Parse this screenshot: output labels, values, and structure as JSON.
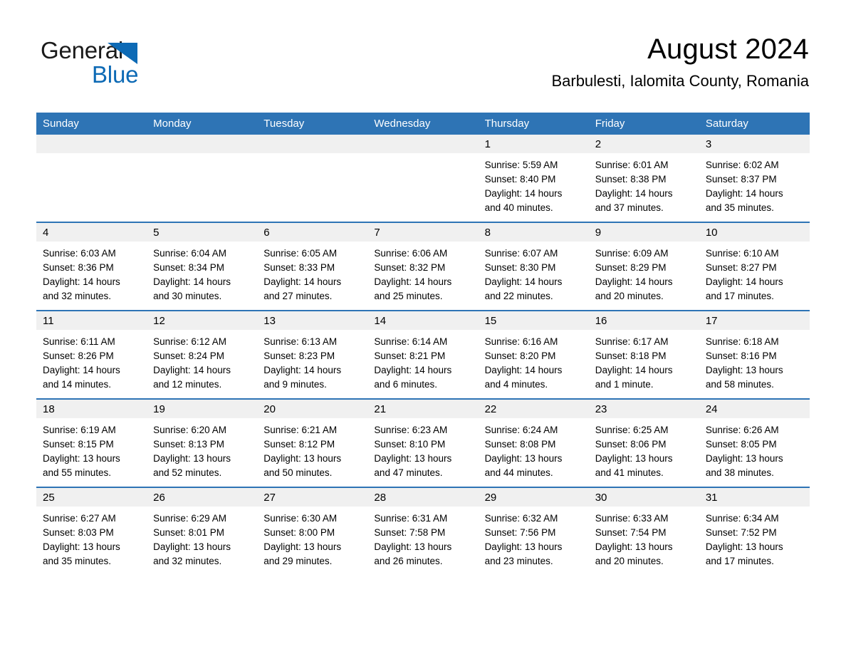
{
  "brand": {
    "name_part1": "General",
    "name_part2": "Blue",
    "accent_color": "#0d6ab5"
  },
  "header": {
    "month_title": "August 2024",
    "location": "Barbulesti, Ialomita County, Romania"
  },
  "calendar": {
    "header_bg": "#2e74b5",
    "daynum_bg": "#f0f0f0",
    "weekday_headers": [
      "Sunday",
      "Monday",
      "Tuesday",
      "Wednesday",
      "Thursday",
      "Friday",
      "Saturday"
    ],
    "labels": {
      "sunrise": "Sunrise:",
      "sunset": "Sunset:",
      "daylight": "Daylight:"
    },
    "weeks": [
      [
        {
          "day": "",
          "empty": true
        },
        {
          "day": "",
          "empty": true
        },
        {
          "day": "",
          "empty": true
        },
        {
          "day": "",
          "empty": true
        },
        {
          "day": "1",
          "sunrise": "Sunrise: 5:59 AM",
          "sunset": "Sunset: 8:40 PM",
          "daylight_line1": "Daylight: 14 hours",
          "daylight_line2": "and 40 minutes."
        },
        {
          "day": "2",
          "sunrise": "Sunrise: 6:01 AM",
          "sunset": "Sunset: 8:38 PM",
          "daylight_line1": "Daylight: 14 hours",
          "daylight_line2": "and 37 minutes."
        },
        {
          "day": "3",
          "sunrise": "Sunrise: 6:02 AM",
          "sunset": "Sunset: 8:37 PM",
          "daylight_line1": "Daylight: 14 hours",
          "daylight_line2": "and 35 minutes."
        }
      ],
      [
        {
          "day": "4",
          "sunrise": "Sunrise: 6:03 AM",
          "sunset": "Sunset: 8:36 PM",
          "daylight_line1": "Daylight: 14 hours",
          "daylight_line2": "and 32 minutes."
        },
        {
          "day": "5",
          "sunrise": "Sunrise: 6:04 AM",
          "sunset": "Sunset: 8:34 PM",
          "daylight_line1": "Daylight: 14 hours",
          "daylight_line2": "and 30 minutes."
        },
        {
          "day": "6",
          "sunrise": "Sunrise: 6:05 AM",
          "sunset": "Sunset: 8:33 PM",
          "daylight_line1": "Daylight: 14 hours",
          "daylight_line2": "and 27 minutes."
        },
        {
          "day": "7",
          "sunrise": "Sunrise: 6:06 AM",
          "sunset": "Sunset: 8:32 PM",
          "daylight_line1": "Daylight: 14 hours",
          "daylight_line2": "and 25 minutes."
        },
        {
          "day": "8",
          "sunrise": "Sunrise: 6:07 AM",
          "sunset": "Sunset: 8:30 PM",
          "daylight_line1": "Daylight: 14 hours",
          "daylight_line2": "and 22 minutes."
        },
        {
          "day": "9",
          "sunrise": "Sunrise: 6:09 AM",
          "sunset": "Sunset: 8:29 PM",
          "daylight_line1": "Daylight: 14 hours",
          "daylight_line2": "and 20 minutes."
        },
        {
          "day": "10",
          "sunrise": "Sunrise: 6:10 AM",
          "sunset": "Sunset: 8:27 PM",
          "daylight_line1": "Daylight: 14 hours",
          "daylight_line2": "and 17 minutes."
        }
      ],
      [
        {
          "day": "11",
          "sunrise": "Sunrise: 6:11 AM",
          "sunset": "Sunset: 8:26 PM",
          "daylight_line1": "Daylight: 14 hours",
          "daylight_line2": "and 14 minutes."
        },
        {
          "day": "12",
          "sunrise": "Sunrise: 6:12 AM",
          "sunset": "Sunset: 8:24 PM",
          "daylight_line1": "Daylight: 14 hours",
          "daylight_line2": "and 12 minutes."
        },
        {
          "day": "13",
          "sunrise": "Sunrise: 6:13 AM",
          "sunset": "Sunset: 8:23 PM",
          "daylight_line1": "Daylight: 14 hours",
          "daylight_line2": "and 9 minutes."
        },
        {
          "day": "14",
          "sunrise": "Sunrise: 6:14 AM",
          "sunset": "Sunset: 8:21 PM",
          "daylight_line1": "Daylight: 14 hours",
          "daylight_line2": "and 6 minutes."
        },
        {
          "day": "15",
          "sunrise": "Sunrise: 6:16 AM",
          "sunset": "Sunset: 8:20 PM",
          "daylight_line1": "Daylight: 14 hours",
          "daylight_line2": "and 4 minutes."
        },
        {
          "day": "16",
          "sunrise": "Sunrise: 6:17 AM",
          "sunset": "Sunset: 8:18 PM",
          "daylight_line1": "Daylight: 14 hours",
          "daylight_line2": "and 1 minute."
        },
        {
          "day": "17",
          "sunrise": "Sunrise: 6:18 AM",
          "sunset": "Sunset: 8:16 PM",
          "daylight_line1": "Daylight: 13 hours",
          "daylight_line2": "and 58 minutes."
        }
      ],
      [
        {
          "day": "18",
          "sunrise": "Sunrise: 6:19 AM",
          "sunset": "Sunset: 8:15 PM",
          "daylight_line1": "Daylight: 13 hours",
          "daylight_line2": "and 55 minutes."
        },
        {
          "day": "19",
          "sunrise": "Sunrise: 6:20 AM",
          "sunset": "Sunset: 8:13 PM",
          "daylight_line1": "Daylight: 13 hours",
          "daylight_line2": "and 52 minutes."
        },
        {
          "day": "20",
          "sunrise": "Sunrise: 6:21 AM",
          "sunset": "Sunset: 8:12 PM",
          "daylight_line1": "Daylight: 13 hours",
          "daylight_line2": "and 50 minutes."
        },
        {
          "day": "21",
          "sunrise": "Sunrise: 6:23 AM",
          "sunset": "Sunset: 8:10 PM",
          "daylight_line1": "Daylight: 13 hours",
          "daylight_line2": "and 47 minutes."
        },
        {
          "day": "22",
          "sunrise": "Sunrise: 6:24 AM",
          "sunset": "Sunset: 8:08 PM",
          "daylight_line1": "Daylight: 13 hours",
          "daylight_line2": "and 44 minutes."
        },
        {
          "day": "23",
          "sunrise": "Sunrise: 6:25 AM",
          "sunset": "Sunset: 8:06 PM",
          "daylight_line1": "Daylight: 13 hours",
          "daylight_line2": "and 41 minutes."
        },
        {
          "day": "24",
          "sunrise": "Sunrise: 6:26 AM",
          "sunset": "Sunset: 8:05 PM",
          "daylight_line1": "Daylight: 13 hours",
          "daylight_line2": "and 38 minutes."
        }
      ],
      [
        {
          "day": "25",
          "sunrise": "Sunrise: 6:27 AM",
          "sunset": "Sunset: 8:03 PM",
          "daylight_line1": "Daylight: 13 hours",
          "daylight_line2": "and 35 minutes."
        },
        {
          "day": "26",
          "sunrise": "Sunrise: 6:29 AM",
          "sunset": "Sunset: 8:01 PM",
          "daylight_line1": "Daylight: 13 hours",
          "daylight_line2": "and 32 minutes."
        },
        {
          "day": "27",
          "sunrise": "Sunrise: 6:30 AM",
          "sunset": "Sunset: 8:00 PM",
          "daylight_line1": "Daylight: 13 hours",
          "daylight_line2": "and 29 minutes."
        },
        {
          "day": "28",
          "sunrise": "Sunrise: 6:31 AM",
          "sunset": "Sunset: 7:58 PM",
          "daylight_line1": "Daylight: 13 hours",
          "daylight_line2": "and 26 minutes."
        },
        {
          "day": "29",
          "sunrise": "Sunrise: 6:32 AM",
          "sunset": "Sunset: 7:56 PM",
          "daylight_line1": "Daylight: 13 hours",
          "daylight_line2": "and 23 minutes."
        },
        {
          "day": "30",
          "sunrise": "Sunrise: 6:33 AM",
          "sunset": "Sunset: 7:54 PM",
          "daylight_line1": "Daylight: 13 hours",
          "daylight_line2": "and 20 minutes."
        },
        {
          "day": "31",
          "sunrise": "Sunrise: 6:34 AM",
          "sunset": "Sunset: 7:52 PM",
          "daylight_line1": "Daylight: 13 hours",
          "daylight_line2": "and 17 minutes."
        }
      ]
    ]
  }
}
